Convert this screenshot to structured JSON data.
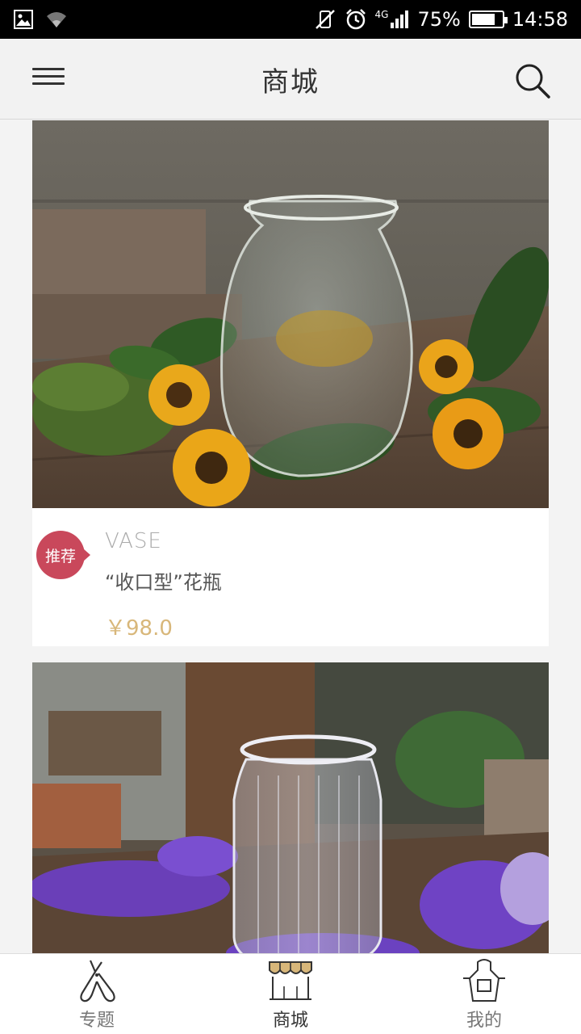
{
  "status_bar": {
    "network": "4G",
    "battery": "75%",
    "time": "14:58"
  },
  "app_bar": {
    "title": "商城",
    "menu_icon": "hamburger-menu-icon",
    "search_icon": "search-icon"
  },
  "products": [
    {
      "badge": "推荐",
      "brand": "VASE",
      "name": "“收口型”花瓶",
      "price": "￥98.0"
    },
    {}
  ],
  "bottom_nav": {
    "items": [
      {
        "label": "专题",
        "icon": "pruning-shears-icon"
      },
      {
        "label": "商城",
        "icon": "storefront-icon"
      },
      {
        "label": "我的",
        "icon": "apron-icon"
      }
    ],
    "active_color": "#d8b77a"
  }
}
